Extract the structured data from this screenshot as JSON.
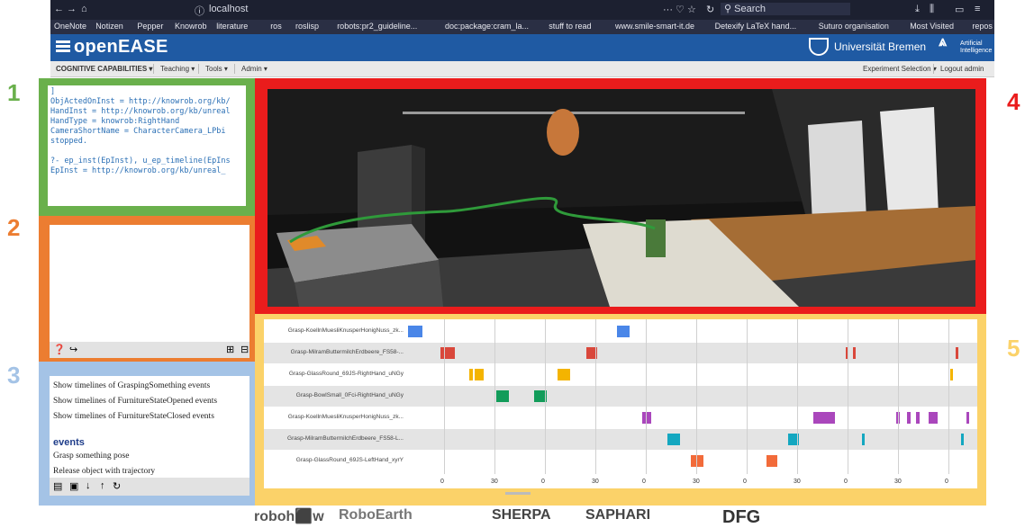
{
  "browser": {
    "url": "localhost",
    "search_placeholder": "Search",
    "bookmarks": [
      "OneNote",
      "Notizen",
      "Pepper",
      "Knowrob",
      "literature",
      "ros",
      "roslisp",
      "robots:pr2_guideline...",
      "doc:package:cram_la...",
      "stuff to read",
      "www.smile-smart-it.de",
      "Detexify LaTeX hand...",
      "Suturo organisation",
      "Most Visited",
      "repos"
    ]
  },
  "app": {
    "brand": "openEASE",
    "university": "Universität Bremen",
    "ai_logo_line1": "Artificial",
    "ai_logo_line2": "Intelligence"
  },
  "menu": {
    "left": [
      "COGNITIVE CAPABILITIES ▾",
      "Teaching ▾",
      "Tools ▾",
      "Admin ▾"
    ],
    "right": [
      "Experiment Selection ▾",
      "Logout admin"
    ]
  },
  "panel_numbers": [
    "1",
    "2",
    "3",
    "4",
    "5"
  ],
  "colors": {
    "panel1": "#6ab04c",
    "panel2": "#ec7d31",
    "panel3": "#a4c3e6",
    "panel4": "#ea1c1c",
    "panel5": "#fbd269",
    "header": "#1f5aa3"
  },
  "console": {
    "lines": [
      "]",
      "ObjActedOnInst = http://knowrob.org/kb/",
      "HandInst = http://knowrob.org/kb/unreal",
      "HandType = knowrob:RightHand",
      "CameraShortName = CharacterCamera_LPbi",
      "stopped.",
      "",
      "?- ep_inst(EpInst), u_ep_timeline(EpIns",
      "EpInst = http://knowrob.org/kb/unreal_"
    ]
  },
  "query_panel": {
    "items": [
      "Show timelines of GraspingSomething events",
      "Show timelines of FurnitureStateOpened events",
      "Show timelines of FurnitureStateClosed events"
    ],
    "section_title": "events",
    "events": [
      "Grasp something pose",
      "Release object with trajectory"
    ]
  },
  "timeline": {
    "rows": [
      {
        "label": "Grasp-KoellnMuesliKnusperHonigNuss_zk...",
        "color": "#4a86e8"
      },
      {
        "label": "Grasp-MilramButtermilchErdbeere_FS58-...",
        "color": "#d9473b"
      },
      {
        "label": "Grasp-GlassRound_69JS-RightHand_uNGy",
        "color": "#f4b400"
      },
      {
        "label": "Grasp-BowlSmall_0Fci-RightHand_uNGy",
        "color": "#129c5a"
      },
      {
        "label": "Grasp-KoellnMuesliKnusperHonigNuss_zk...",
        "color": "#aa47bc"
      },
      {
        "label": "Grasp-MilramButtermilchErdbeere_FS58-L...",
        "color": "#14a7c0"
      },
      {
        "label": "Grasp-GlassRound_69JS-LeftHand_xyrY",
        "color": "#f26b3a"
      }
    ],
    "ticks": [
      "0",
      "30",
      "0",
      "30",
      "0",
      "30",
      "0",
      "30",
      "0",
      "30",
      "0"
    ]
  },
  "footer": {
    "logos": [
      "roboh⬛w",
      "RoboEarth",
      "SHERPA",
      "SAPHARI",
      "DFG"
    ]
  }
}
